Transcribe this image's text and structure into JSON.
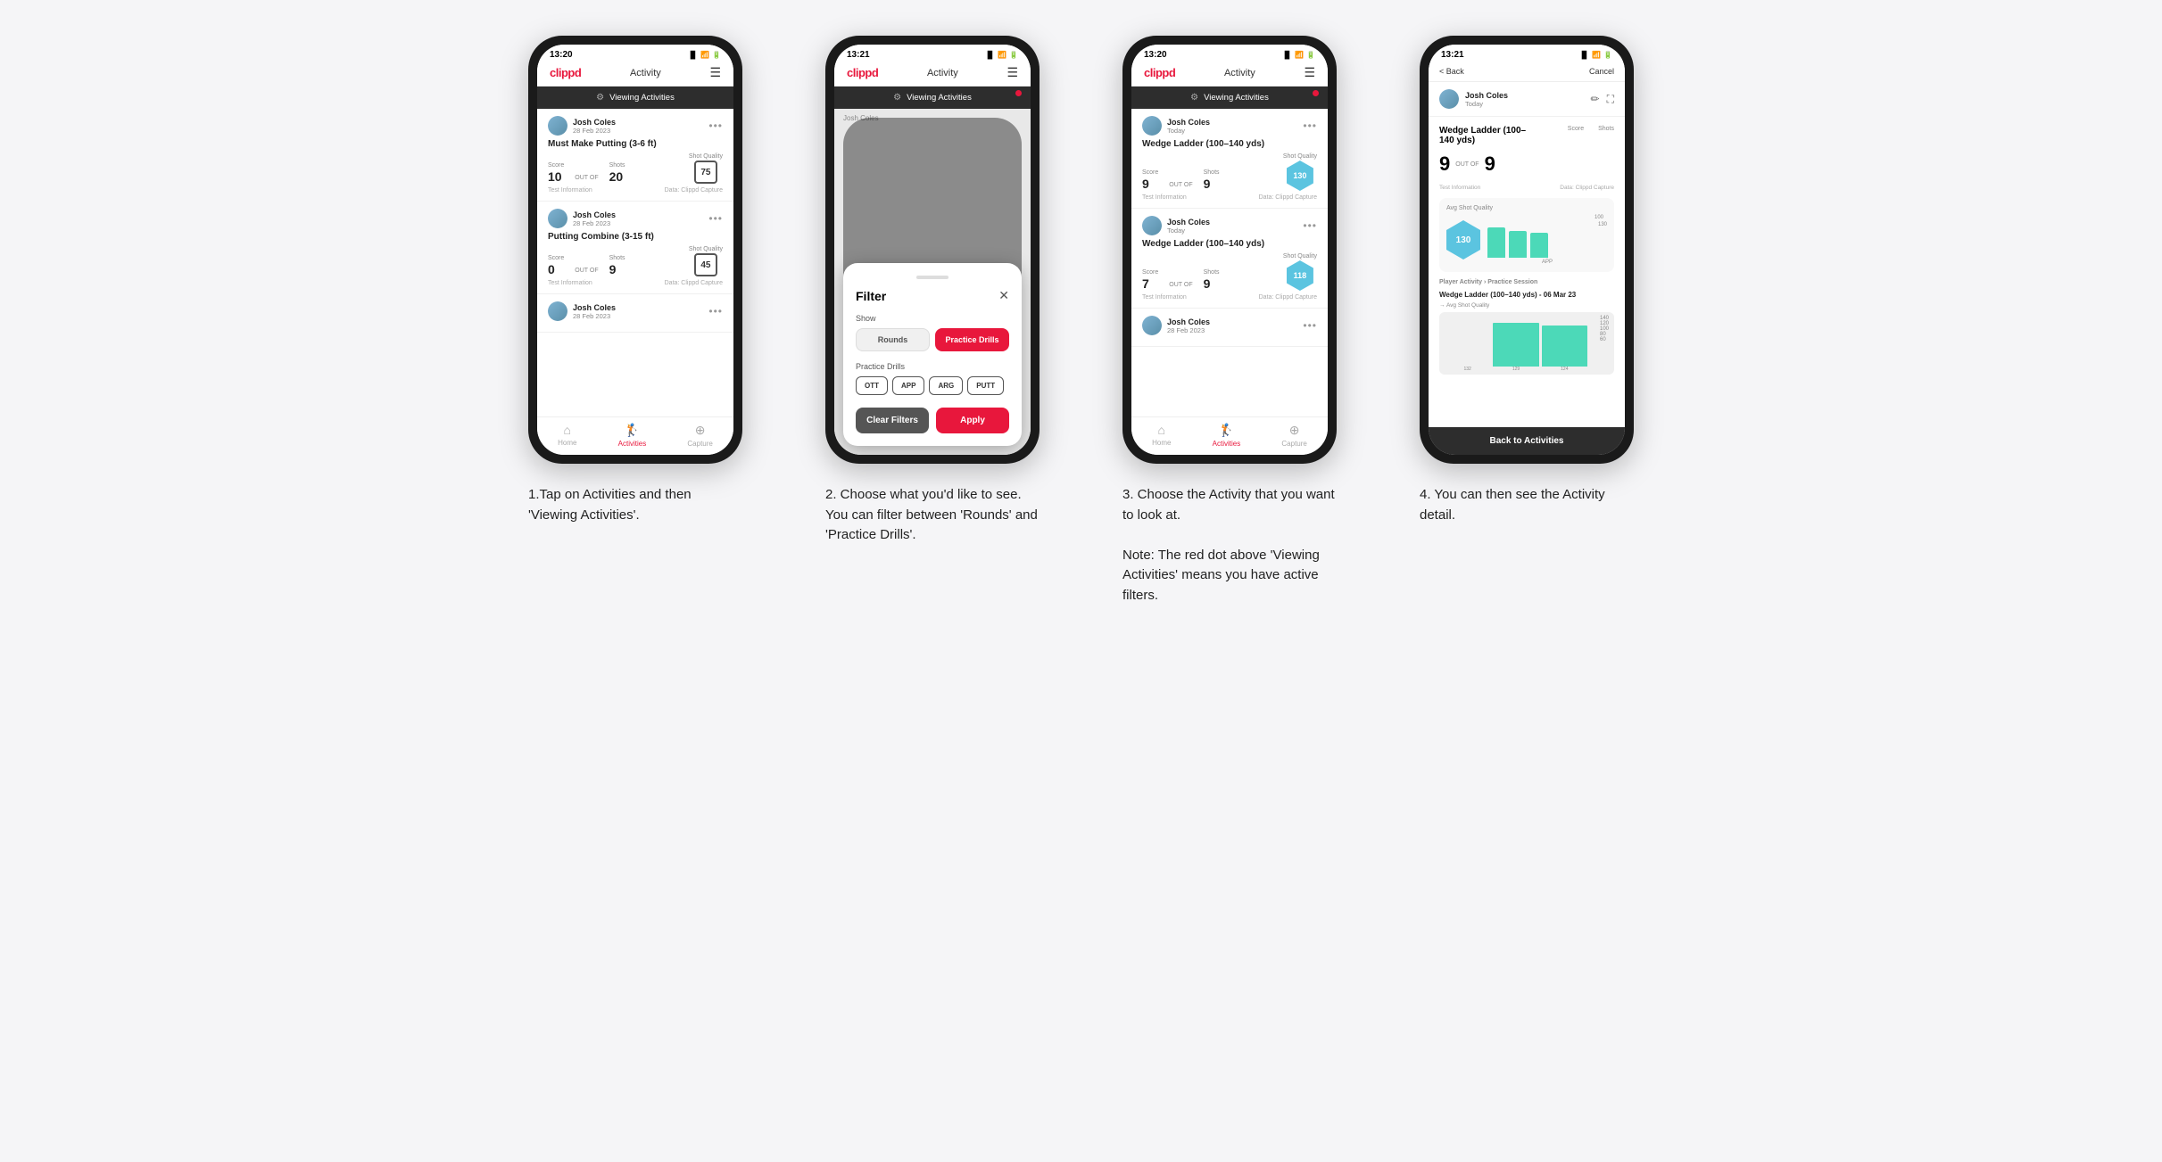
{
  "steps": [
    {
      "id": "step1",
      "phone": {
        "statusBar": {
          "time": "13:20",
          "icons": "▐▌ ᯤ 44"
        },
        "nav": {
          "logo": "clippd",
          "title": "Activity",
          "menu": "☰"
        },
        "banner": {
          "icon": "⚙",
          "label": "Viewing Activities",
          "hasDot": false
        },
        "cards": [
          {
            "user": "Josh Coles",
            "date": "28 Feb 2023",
            "drill": "Must Make Putting (3-6 ft)",
            "scoreLabel": "Score",
            "shotsLabel": "Shots",
            "qualityLabel": "Shot Quality",
            "score": "10",
            "outof": "OUT OF",
            "shots": "20",
            "quality": "75",
            "infoLeft": "Test Information",
            "infoRight": "Data: Clippd Capture"
          },
          {
            "user": "Josh Coles",
            "date": "28 Feb 2023",
            "drill": "Putting Combine (3-15 ft)",
            "scoreLabel": "Score",
            "shotsLabel": "Shots",
            "qualityLabel": "Shot Quality",
            "score": "0",
            "outof": "OUT OF",
            "shots": "9",
            "quality": "45",
            "infoLeft": "Test Information",
            "infoRight": "Data: Clippd Capture"
          },
          {
            "user": "Josh Coles",
            "date": "28 Feb 2023",
            "drill": "",
            "scoreLabel": "",
            "shotsLabel": "",
            "qualityLabel": "",
            "score": "",
            "outof": "",
            "shots": "",
            "quality": "",
            "infoLeft": "",
            "infoRight": ""
          }
        ],
        "bottomNav": [
          {
            "label": "Home",
            "icon": "⌂",
            "active": false
          },
          {
            "label": "Activities",
            "icon": "♟",
            "active": true
          },
          {
            "label": "Capture",
            "icon": "⊕",
            "active": false
          }
        ]
      },
      "description": "1.Tap on Activities and then 'Viewing Activities'."
    },
    {
      "id": "step2",
      "phone": {
        "statusBar": {
          "time": "13:21",
          "icons": "▐▌ ᯤ 44"
        },
        "nav": {
          "logo": "clippd",
          "title": "Activity",
          "menu": "☰"
        },
        "banner": {
          "icon": "⚙",
          "label": "Viewing Activities",
          "hasDot": true
        },
        "modal": {
          "showLabel": "Show",
          "tabs": [
            {
              "label": "Rounds",
              "active": false
            },
            {
              "label": "Practice Drills",
              "active": true
            }
          ],
          "drillsLabel": "Practice Drills",
          "drillTags": [
            "OTT",
            "APP",
            "ARG",
            "PUTT"
          ],
          "clearLabel": "Clear Filters",
          "applyLabel": "Apply"
        }
      },
      "description": "2. Choose what you'd like to see. You can filter between 'Rounds' and 'Practice Drills'."
    },
    {
      "id": "step3",
      "phone": {
        "statusBar": {
          "time": "13:20",
          "icons": "▐▌ ᯤ 44"
        },
        "nav": {
          "logo": "clippd",
          "title": "Activity",
          "menu": "☰"
        },
        "banner": {
          "icon": "⚙",
          "label": "Viewing Activities",
          "hasDot": true
        },
        "cards": [
          {
            "user": "Josh Coles",
            "date": "Today",
            "drill": "Wedge Ladder (100–140 yds)",
            "scoreLabel": "Score",
            "shotsLabel": "Shots",
            "qualityLabel": "Shot Quality",
            "score": "9",
            "outof": "OUT OF",
            "shots": "9",
            "quality": "130",
            "qualityColor": "#5bc4e0",
            "infoLeft": "Test Information",
            "infoRight": "Data: Clippd Capture"
          },
          {
            "user": "Josh Coles",
            "date": "Today",
            "drill": "Wedge Ladder (100–140 yds)",
            "scoreLabel": "Score",
            "shotsLabel": "Shots",
            "qualityLabel": "Shot Quality",
            "score": "7",
            "outof": "OUT OF",
            "shots": "9",
            "quality": "118",
            "qualityColor": "#5bc4e0",
            "infoLeft": "Test Information",
            "infoRight": "Data: Clippd Capture"
          },
          {
            "user": "Josh Coles",
            "date": "28 Feb 2023",
            "drill": "",
            "scoreLabel": "",
            "shotsLabel": "",
            "qualityLabel": "",
            "score": "",
            "outof": "",
            "shots": "",
            "quality": "",
            "infoLeft": "",
            "infoRight": ""
          }
        ],
        "bottomNav": [
          {
            "label": "Home",
            "icon": "⌂",
            "active": false
          },
          {
            "label": "Activities",
            "icon": "♟",
            "active": true
          },
          {
            "label": "Capture",
            "icon": "⊕",
            "active": false
          }
        ]
      },
      "description": "3. Choose the Activity that you want to look at.\n\nNote: The red dot above 'Viewing Activities' means you have active filters."
    },
    {
      "id": "step4",
      "phone": {
        "statusBar": {
          "time": "13:21",
          "icons": "▐▌ ᯤ 44"
        },
        "detailNav": {
          "back": "< Back",
          "cancel": "Cancel"
        },
        "detailUser": {
          "name": "Josh Coles",
          "date": "Today"
        },
        "detailDrill": "Wedge Ladder (100–140 yds)",
        "scoreLabel": "Score",
        "shotsLabel": "Shots",
        "score": "9",
        "outof": "OUT OF",
        "shots": "9",
        "infoLine1": "Test Information",
        "infoLine2": "Data: Clippd Capture",
        "avgQualityLabel": "Avg Shot Quality",
        "hexValue": "130",
        "chartLabel": "APP",
        "chartValues": [
          132,
          129,
          124
        ],
        "chartDotted": 124,
        "practiceLabel": "Player Activity",
        "practiceType": "Practice Session",
        "historyDrill": "Wedge Ladder (100–140 yds) - 06 Mar 23",
        "historyLabel": "Avg Shot Quality",
        "backLabel": "Back to Activities"
      },
      "description": "4. You can then see the Activity detail."
    }
  ]
}
